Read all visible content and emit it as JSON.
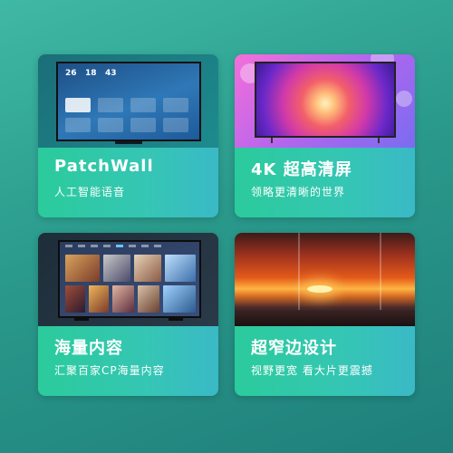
{
  "cards": [
    {
      "title": "PatchWall",
      "subtitle": "人工智能语音"
    },
    {
      "title": "4K 超高清屏",
      "subtitle": "领略更清晰的世界"
    },
    {
      "title": "海量内容",
      "subtitle": "汇聚百家CP海量内容"
    },
    {
      "title": "超窄边设计",
      "subtitle": "视野更宽 看大片更震撼"
    }
  ],
  "patchwall_screen": {
    "clock_a": "26",
    "clock_b": "18",
    "clock_c": "43"
  },
  "colors": {
    "caption_gradient_start": "#2bcb9c",
    "caption_gradient_end": "#3ab9c6",
    "background": "#2a9a8c"
  },
  "icons": [
    "tv-screen-icon"
  ]
}
